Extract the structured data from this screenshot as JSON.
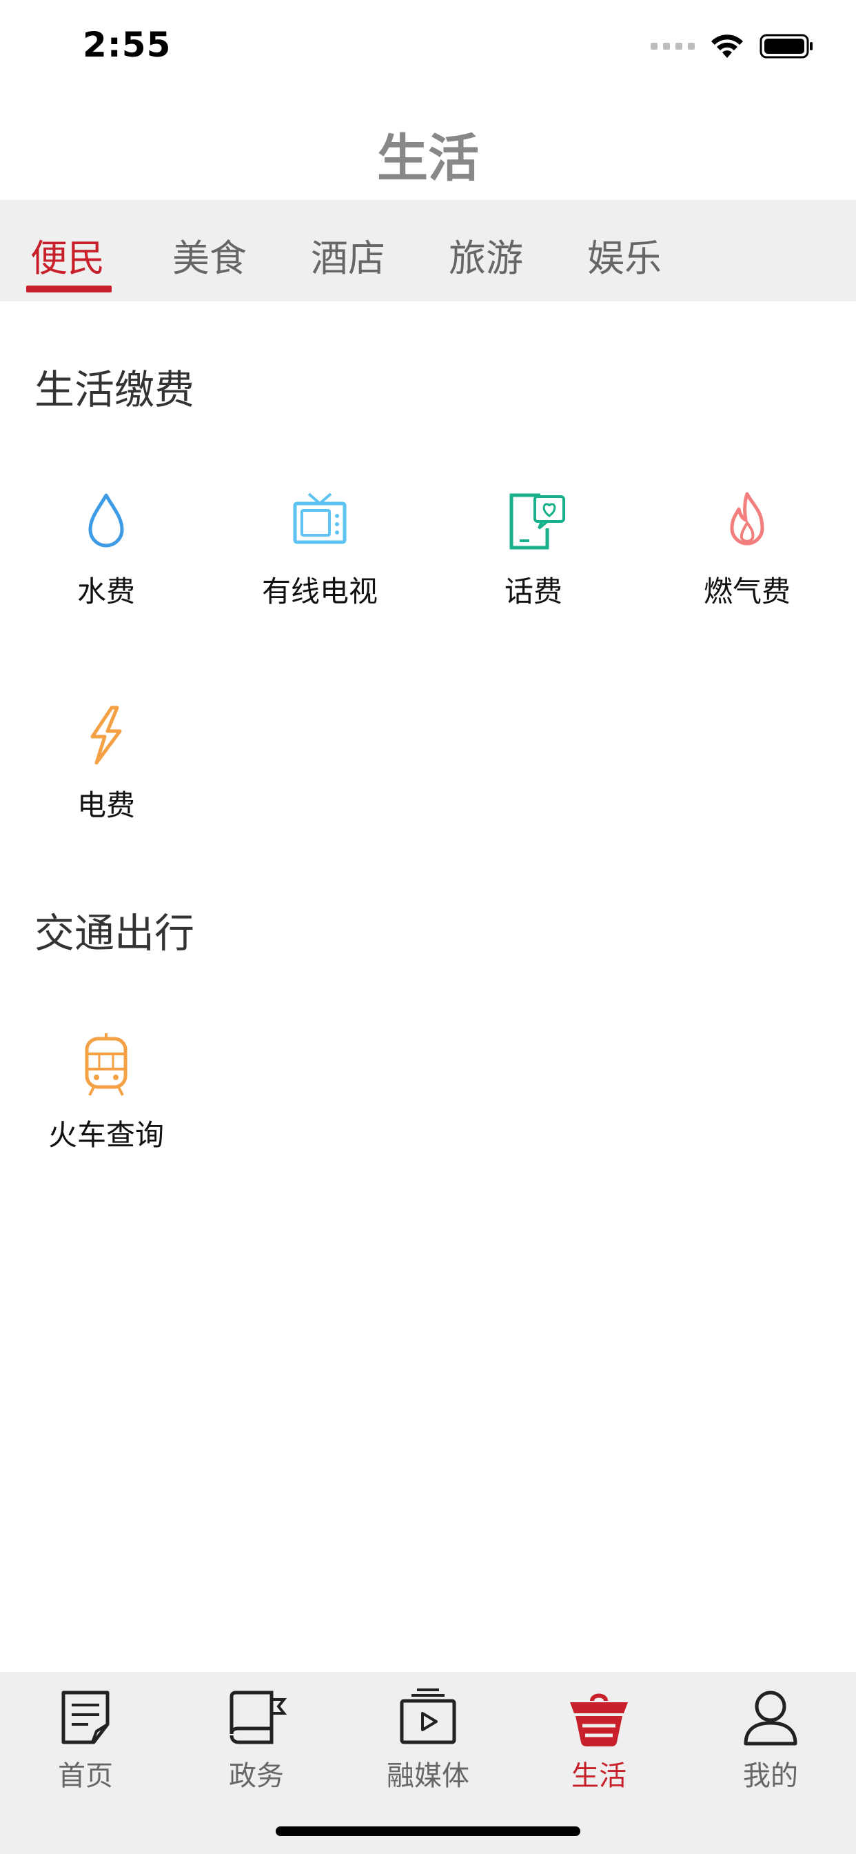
{
  "status": {
    "time": "2:55"
  },
  "header": {
    "title": "生活"
  },
  "tabs": [
    {
      "label": "便民",
      "active": true
    },
    {
      "label": "美食"
    },
    {
      "label": "酒店"
    },
    {
      "label": "旅游"
    },
    {
      "label": "娱乐"
    }
  ],
  "sections": {
    "utilities": {
      "title": "生活缴费",
      "items": [
        {
          "label": "水费",
          "icon": "water-drop-icon"
        },
        {
          "label": "有线电视",
          "icon": "tv-icon"
        },
        {
          "label": "话费",
          "icon": "phone-bill-icon"
        },
        {
          "label": "燃气费",
          "icon": "flame-icon"
        },
        {
          "label": "电费",
          "icon": "lightning-icon"
        }
      ]
    },
    "transport": {
      "title": "交通出行",
      "items": [
        {
          "label": "火车查询",
          "icon": "train-icon"
        }
      ]
    }
  },
  "bottom_nav": [
    {
      "label": "首页",
      "icon": "news-icon"
    },
    {
      "label": "政务",
      "icon": "book-flag-icon"
    },
    {
      "label": "融媒体",
      "icon": "media-tv-icon"
    },
    {
      "label": "生活",
      "icon": "basket-icon",
      "active": true
    },
    {
      "label": "我的",
      "icon": "user-icon"
    }
  ],
  "colors": {
    "accent": "#c8202a",
    "water": "#3e9be6",
    "tv": "#5ec3f2",
    "phone": "#17b08a",
    "flame": "#f27e7e",
    "electric": "#f4a044",
    "train": "#f4a044"
  }
}
